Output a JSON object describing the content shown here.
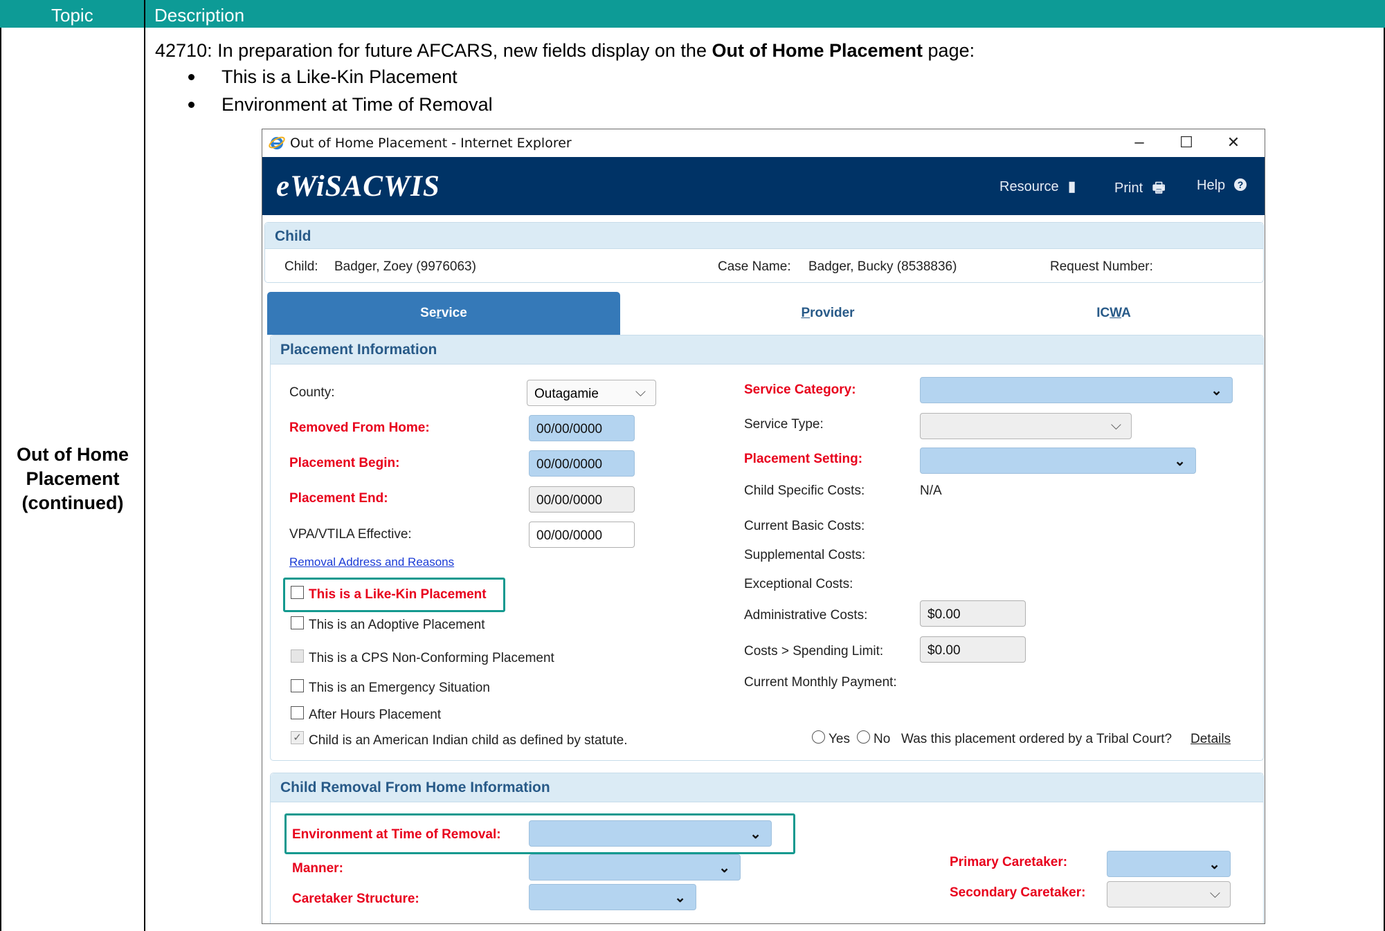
{
  "doc": {
    "header_topic": "Topic",
    "header_description": "Description",
    "topic_line1": "Out of Home",
    "topic_line2": "Placement",
    "topic_line3": "(continued)",
    "intro_prefix": "42710: In preparation for future AFCARS, new fields display on the ",
    "intro_bold": "Out of Home Placement",
    "intro_suffix": " page:",
    "bullets": [
      "This is a Like-Kin Placement",
      "Environment at Time of Removal"
    ]
  },
  "window": {
    "title": "Out of Home Placement - Internet Explorer",
    "minimize": "–",
    "maximize": "☐",
    "close": "✕"
  },
  "app": {
    "logo": "eWiSACWIS",
    "nav": [
      {
        "label": "Resource",
        "icon": "book-icon"
      },
      {
        "label": "Print",
        "icon": "printer-icon"
      },
      {
        "label": "Help",
        "icon": "help-icon"
      }
    ]
  },
  "child_panel": {
    "title": "Child",
    "child_label": "Child:",
    "child_value": "Badger, Zoey (9976063)",
    "case_label": "Case Name:",
    "case_value": "Badger, Bucky (8538836)",
    "request_label": "Request Number:"
  },
  "tabs": {
    "service_pre": "Se",
    "service_u": "r",
    "service_post": "vice",
    "provider_u": "P",
    "provider_post": "rovider",
    "icwa_pre": "IC",
    "icwa_u": "W",
    "icwa_post": "A"
  },
  "placement": {
    "title": "Placement Information",
    "county_label": "County:",
    "county_value": "Outagamie",
    "removed_label": "Removed From Home:",
    "removed_value": "00/00/0000",
    "begin_label": "Placement Begin:",
    "begin_value": "00/00/0000",
    "end_label": "Placement End:",
    "end_value": "00/00/0000",
    "vpa_label": "VPA/VTILA Effective:",
    "vpa_value": "00/00/0000",
    "removal_link": "Removal Address and Reasons",
    "cb_likekin": "This is a Like-Kin Placement",
    "cb_adoptive": "This is an Adoptive Placement",
    "cb_cps": "This is a CPS Non-Conforming Placement",
    "cb_emergency": "This is an Emergency Situation",
    "cb_afterhours": "After Hours Placement",
    "cb_indian": "Child is an American Indian child as defined by statute.",
    "service_category_label": "Service Category:",
    "service_type_label": "Service Type:",
    "placement_setting_label": "Placement Setting:",
    "child_costs_label": "Child Specific Costs:",
    "child_costs_value": "N/A",
    "basic_costs_label": "Current Basic Costs:",
    "supp_costs_label": "Supplemental Costs:",
    "exc_costs_label": "Exceptional Costs:",
    "admin_costs_label": "Administrative Costs:",
    "admin_costs_value": "$0.00",
    "spending_label": "Costs > Spending Limit:",
    "spending_value": "$0.00",
    "monthly_label": "Current Monthly Payment:",
    "radio_yes": "Yes",
    "radio_no": "No",
    "tribal_question": "Was this placement ordered by a Tribal Court?",
    "details_link": "Details"
  },
  "removal": {
    "title": "Child Removal From Home Information",
    "env_label": "Environment at Time of Removal:",
    "manner_label": "Manner:",
    "caretaker_structure_label": "Caretaker Structure:",
    "primary_label": "Primary Caretaker:",
    "secondary_label": "Secondary Caretaker:"
  },
  "colors": {
    "header_teal": "#0d9b96",
    "app_navy": "#003366",
    "required_red": "#e8001c",
    "highlight_teal": "#14998f",
    "field_blue": "#b4d4f0"
  }
}
